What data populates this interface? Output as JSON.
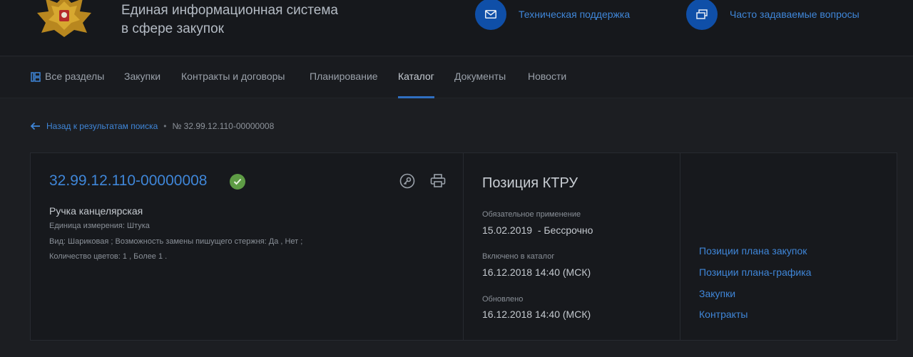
{
  "header": {
    "title_line1": "Единая информационная система",
    "title_line2": "в сфере закупок",
    "support_label": "Техническая поддержка",
    "faq_label": "Часто задаваемые вопросы"
  },
  "nav": {
    "items": [
      {
        "label": "Все разделы"
      },
      {
        "label": "Закупки"
      },
      {
        "label": "Контракты и договоры"
      },
      {
        "label": "Планирование"
      },
      {
        "label": "Каталог"
      },
      {
        "label": "Документы"
      },
      {
        "label": "Новости"
      }
    ],
    "active": "Каталог"
  },
  "breadcrumb": {
    "back_label": "Назад к результатам поиска",
    "separator": "•",
    "current": "№ 32.99.12.110-00000008"
  },
  "item": {
    "code": "32.99.12.110-00000008",
    "name": "Ручка канцелярская",
    "unit": "Единица измерения: Штука",
    "attrs_line1": "Вид: Шариковая ; Возможность замены пишущего стержня: Да , Нет ;",
    "attrs_line2": "Количество цветов: 1 , Более 1 ."
  },
  "ktru": {
    "title": "Позиция КТРУ",
    "mandatory_label": "Обязательное применение",
    "mandatory_value": "15.02.2019  - Бессрочно",
    "included_label": "Включено в каталог",
    "included_value": "16.12.2018 14:40 (МСК)",
    "updated_label": "Обновлено",
    "updated_value": "16.12.2018 14:40 (МСК)"
  },
  "links": {
    "plan_positions": "Позиции плана закупок",
    "schedule_positions": "Позиции плана-графика",
    "purchases": "Закупки",
    "contracts": "Контракты"
  },
  "colors": {
    "accent": "#3f86d8",
    "accent_circle": "#0f4fa8",
    "status_ok": "#5e9c45",
    "background": "#1c1e22"
  }
}
